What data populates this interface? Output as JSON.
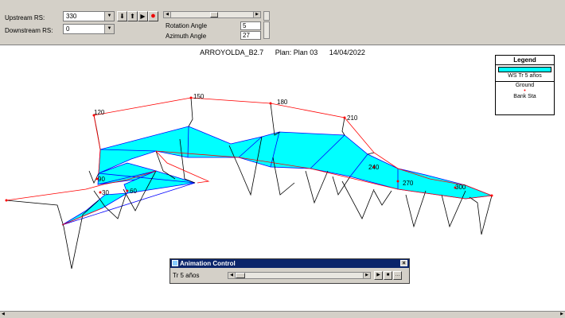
{
  "toolbar": {
    "upstream_label": "Upstream RS:",
    "upstream_value": "330",
    "downstream_label": "Downstream RS:",
    "downstream_value": "0",
    "rotation_label": "Rotation Angle",
    "rotation_value": "5",
    "azimuth_label": "Azimuth Angle",
    "azimuth_value": "27",
    "buttons": [
      "arrow-down-icon",
      "arrow-up-icon",
      "play-icon",
      "record-icon"
    ]
  },
  "plot": {
    "title_name": "ARROYOLDA_B2.7",
    "title_plan": "Plan: Plan 03",
    "title_date": "14/04/2022"
  },
  "legend": {
    "title": "Legend",
    "items": [
      "WS Tr 5 años",
      "Ground",
      "Bank Sta"
    ]
  },
  "station_labels": [
    "120",
    "150",
    "180",
    "210",
    "240",
    "270",
    "300",
    "90",
    "30",
    "60"
  ],
  "colors": {
    "water": "#00ffff",
    "bank": "#ff0000",
    "ground": "#000000",
    "ws_line": "#0000ff"
  },
  "animation": {
    "title": "Animation Control",
    "profile": "Tr 5 años"
  }
}
